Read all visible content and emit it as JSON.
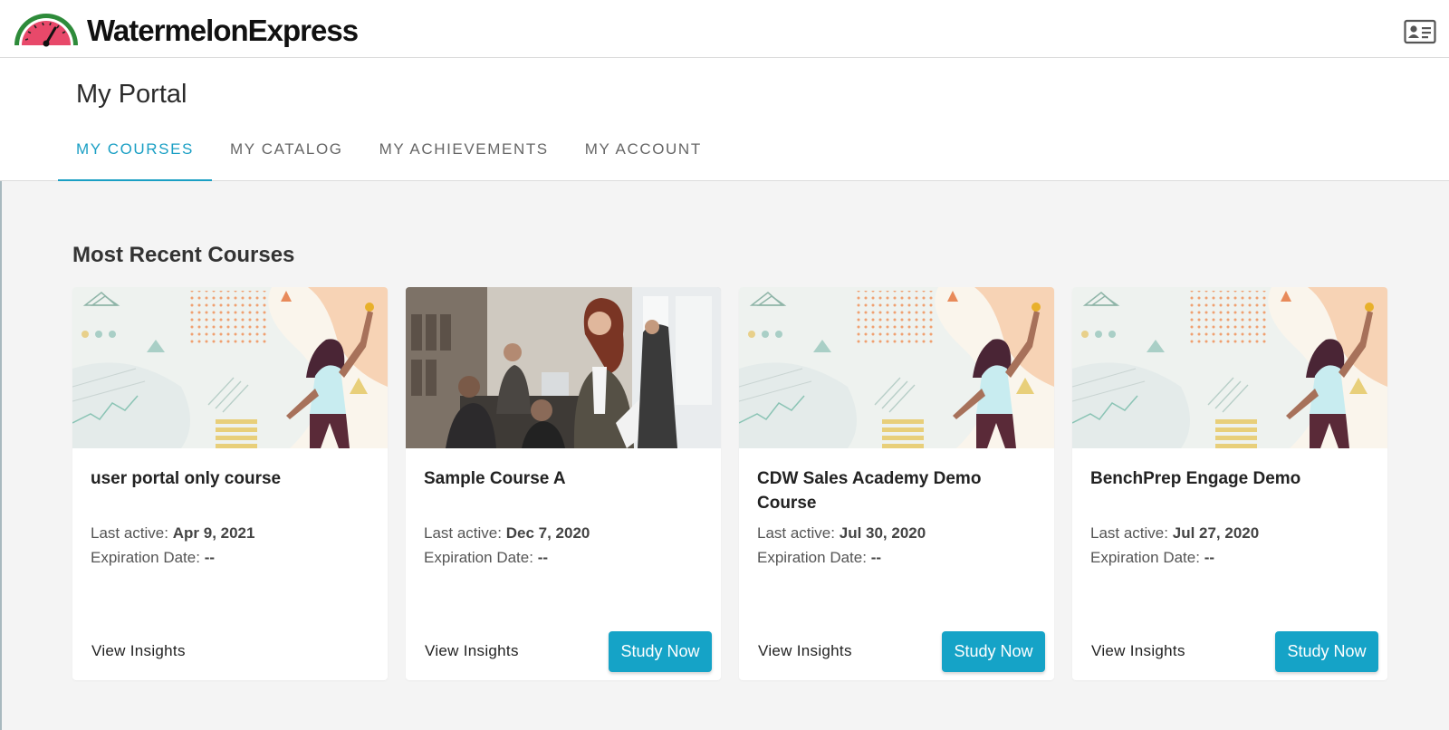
{
  "app": {
    "brand": "WatermelonExpress",
    "colors": {
      "accent": "#1a9fc4",
      "button": "#15a3c7",
      "logo_red": "#e8496a",
      "logo_green": "#2e8b3a"
    }
  },
  "header": {
    "page_title": "My Portal",
    "tabs": [
      {
        "label": "MY COURSES",
        "active": true
      },
      {
        "label": "MY CATALOG",
        "active": false
      },
      {
        "label": "MY ACHIEVEMENTS",
        "active": false
      },
      {
        "label": "MY ACCOUNT",
        "active": false
      }
    ]
  },
  "main": {
    "section_title": "Most Recent Courses",
    "courses": [
      {
        "image": "illustration-woman-pointing",
        "title": "user portal only course",
        "last_active_label": "Last active:",
        "last_active": "Apr 9, 2021",
        "expiration_label": "Expiration Date:",
        "expiration": "--",
        "insights_label": "View Insights",
        "study_label": ""
      },
      {
        "image": "photo-office-meeting",
        "title": "Sample Course A",
        "last_active_label": "Last active:",
        "last_active": "Dec 7, 2020",
        "expiration_label": "Expiration Date:",
        "expiration": "--",
        "insights_label": "View Insights",
        "study_label": "Study Now"
      },
      {
        "image": "illustration-woman-pointing",
        "title": "CDW Sales Academy Demo Course",
        "last_active_label": "Last active:",
        "last_active": "Jul 30, 2020",
        "expiration_label": "Expiration Date:",
        "expiration": "--",
        "insights_label": "View Insights",
        "study_label": "Study Now"
      },
      {
        "image": "illustration-woman-pointing",
        "title": "BenchPrep Engage Demo",
        "last_active_label": "Last active:",
        "last_active": "Jul 27, 2020",
        "expiration_label": "Expiration Date:",
        "expiration": "--",
        "insights_label": "View Insights",
        "study_label": "Study Now"
      }
    ]
  }
}
